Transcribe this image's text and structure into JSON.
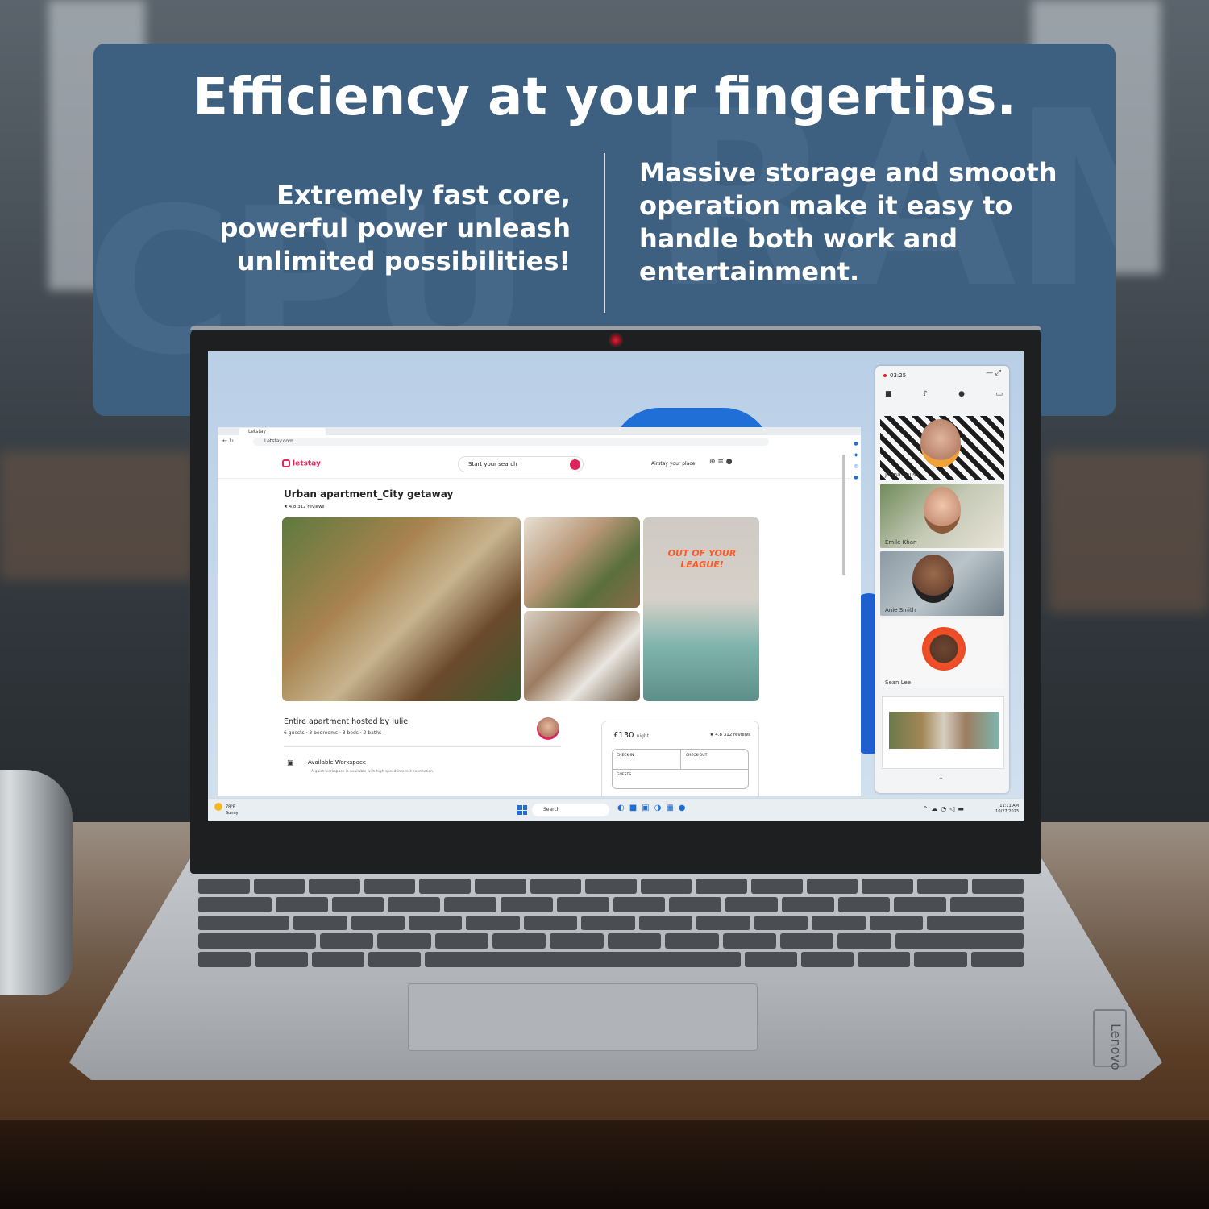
{
  "banner": {
    "headline": "Efficiency at your fingertips.",
    "feature_left": "Extremely fast core, powerful power unleash unlimited possibilities!",
    "feature_right": "Massive storage and smooth operation make it easy to handle both work and entertainment.",
    "watermark_left": "CPU",
    "watermark_right": "RAM"
  },
  "browser": {
    "tab_label": "Letstay",
    "address": "Letstay.com",
    "site": {
      "logo": "letstay",
      "search_placeholder": "Start your search",
      "host_link": "Airstay your place"
    },
    "listing": {
      "title": "Urban apartment_City getaway",
      "rating": "★ 4.8  312 reviews",
      "neon_sign": "OUT OF YOUR LEAGUE!",
      "host_title": "Entire apartment hosted by Julie",
      "host_details": "6 guests · 3 bedrooms · 3 beds · 2 baths",
      "amenity_title": "Available Workspace",
      "amenity_desc": "A quiet workspace is available with high speed internet connection."
    },
    "booking": {
      "price": "£130",
      "price_unit": "night",
      "rating": "★ 4.8  312 reviews",
      "checkin_label": "CHECK-IN",
      "checkout_label": "CHECK-OUT",
      "guests_label": "GUESTS"
    }
  },
  "call": {
    "timer": "03:25",
    "participants": [
      {
        "name": "Joana Sousa"
      },
      {
        "name": "Emile Khan"
      },
      {
        "name": "Anie Smith"
      },
      {
        "name": "Sean Lee"
      }
    ]
  },
  "taskbar": {
    "weather_temp": "78°F",
    "weather_cond": "Sunny",
    "search_label": "Search",
    "time": "11:11 AM",
    "date": "10/27/2023"
  },
  "laptop": {
    "brand": "Lenovo"
  },
  "colors": {
    "banner": "#3d5f80",
    "accent": "#e0245e",
    "windows_blue": "#1f6fd6"
  }
}
